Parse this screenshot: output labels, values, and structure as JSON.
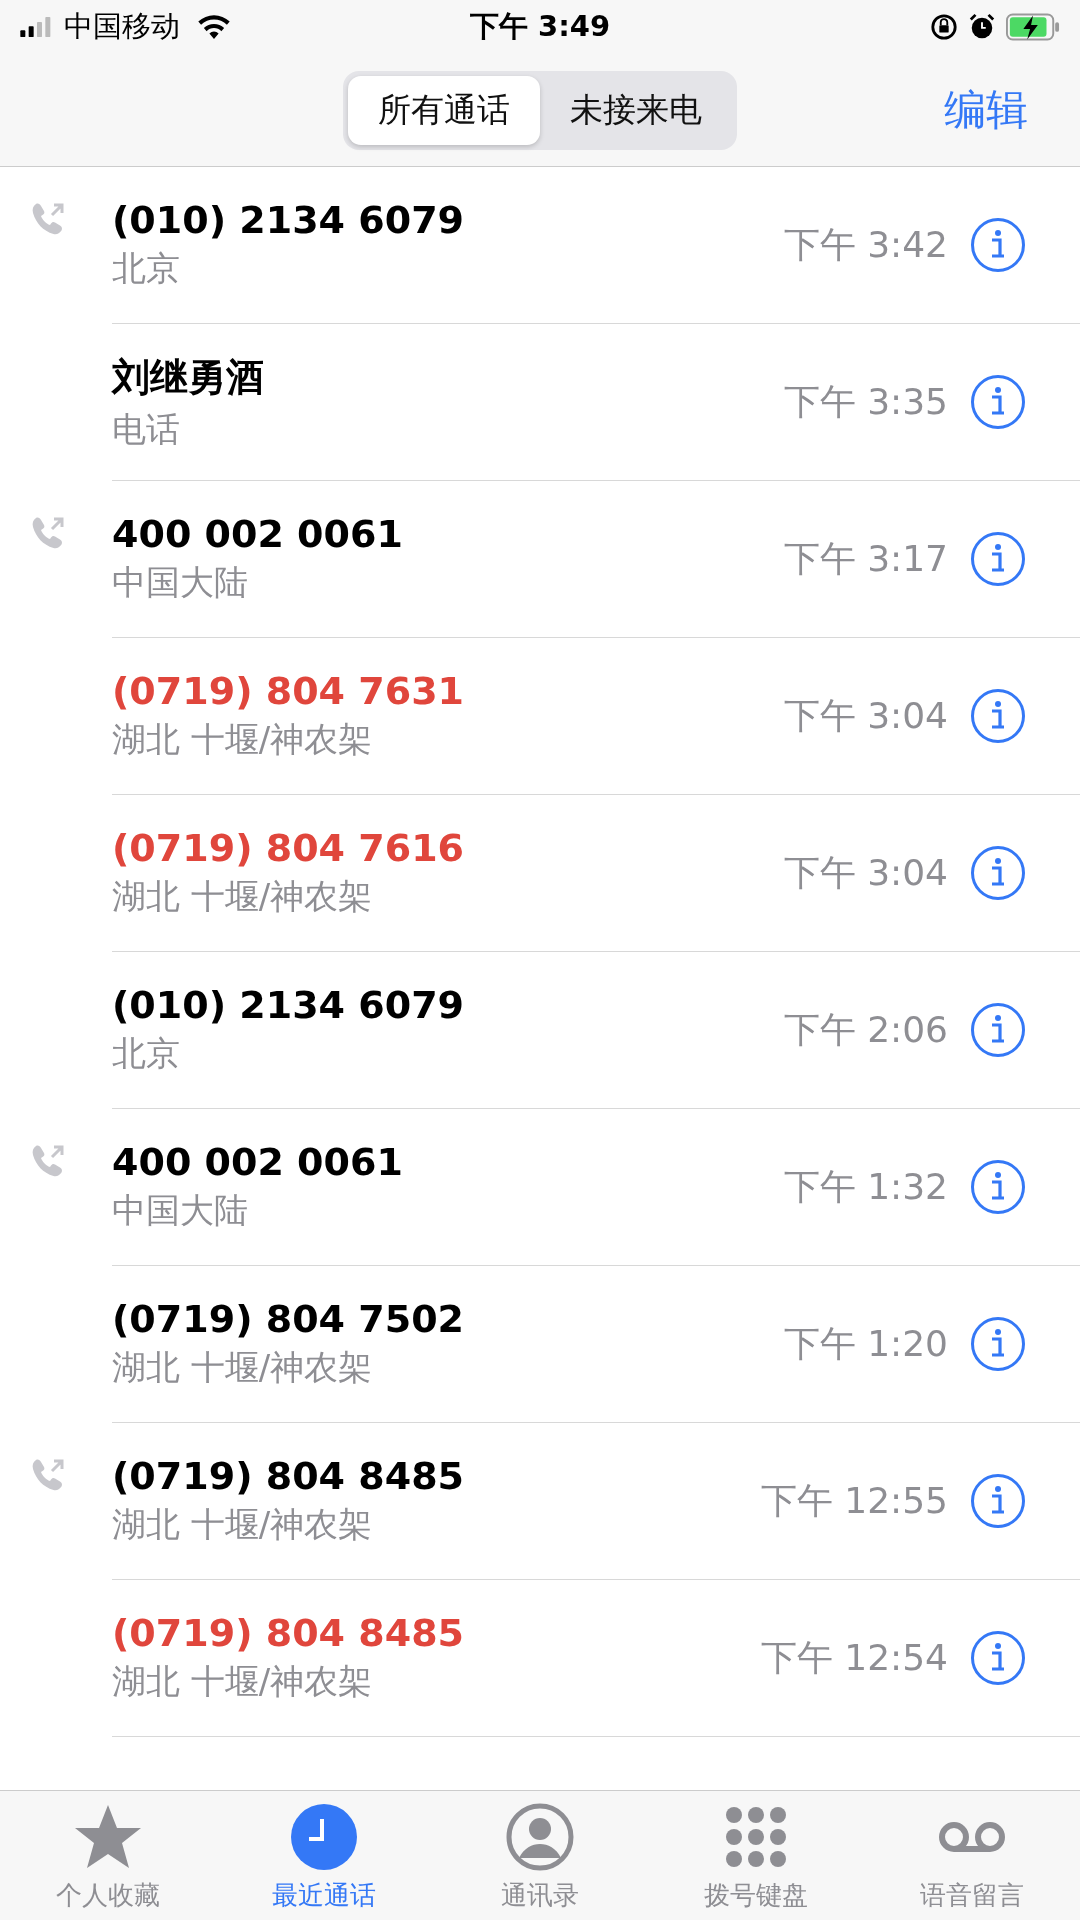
{
  "status_bar": {
    "carrier": "中国移动",
    "time": "下午 3:49"
  },
  "segments": [
    {
      "label": "所有通话",
      "selected": true
    },
    {
      "label": "未接来电",
      "selected": false
    }
  ],
  "edit_button": "编辑",
  "calls": [
    {
      "number": "(010) 2134 6079",
      "location": "北京",
      "time": "下午 3:42",
      "missed": false,
      "outgoing": true
    },
    {
      "number": "刘继勇酒",
      "location": "电话",
      "time": "下午 3:35",
      "missed": false,
      "outgoing": false
    },
    {
      "number": "400 002 0061",
      "location": "中国大陆",
      "time": "下午 3:17",
      "missed": false,
      "outgoing": true
    },
    {
      "number": "(0719) 804 7631",
      "location": "湖北 十堰/神农架",
      "time": "下午 3:04",
      "missed": true,
      "outgoing": false
    },
    {
      "number": "(0719) 804 7616",
      "location": "湖北 十堰/神农架",
      "time": "下午 3:04",
      "missed": true,
      "outgoing": false
    },
    {
      "number": "(010) 2134 6079",
      "location": "北京",
      "time": "下午 2:06",
      "missed": false,
      "outgoing": false
    },
    {
      "number": "400 002 0061",
      "location": "中国大陆",
      "time": "下午 1:32",
      "missed": false,
      "outgoing": true
    },
    {
      "number": "(0719) 804 7502",
      "location": "湖北 十堰/神农架",
      "time": "下午 1:20",
      "missed": false,
      "outgoing": false
    },
    {
      "number": "(0719) 804 8485",
      "location": "湖北 十堰/神农架",
      "time": "下午 12:55",
      "missed": false,
      "outgoing": true
    },
    {
      "number": "(0719) 804 8485",
      "location": "湖北 十堰/神农架",
      "time": "下午 12:54",
      "missed": true,
      "outgoing": false
    }
  ],
  "tab_bar": [
    {
      "kind": "star",
      "label": "个人收藏",
      "selected": false
    },
    {
      "kind": "clock",
      "label": "最近通话",
      "selected": true
    },
    {
      "kind": "person",
      "label": "通讯录",
      "selected": false
    },
    {
      "kind": "keypad",
      "label": "拨号键盘",
      "selected": false
    },
    {
      "kind": "voicemail",
      "label": "语音留言",
      "selected": false
    }
  ]
}
